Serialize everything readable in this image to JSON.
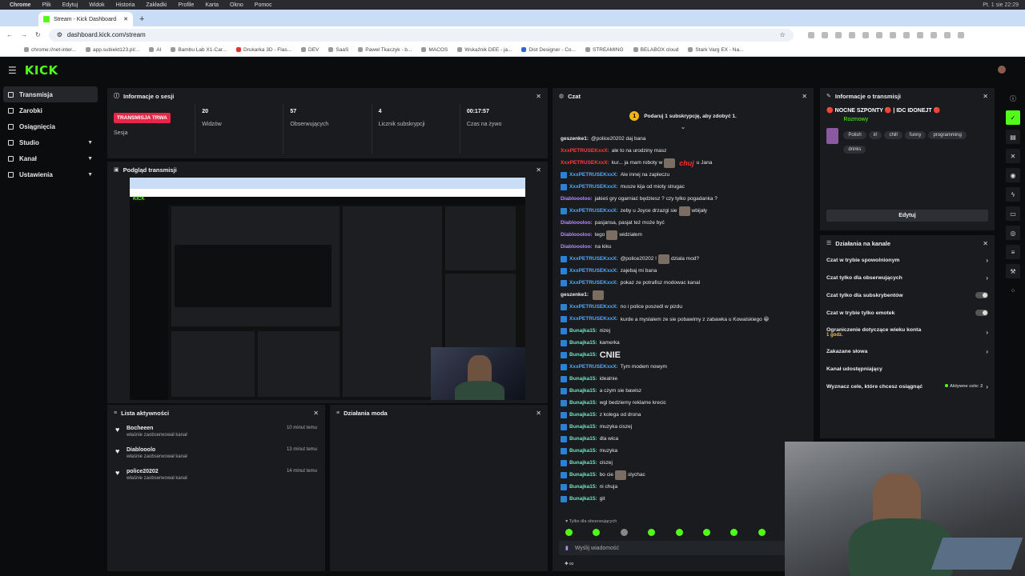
{
  "mac": {
    "apple": "",
    "menu": [
      "Chrome",
      "Plik",
      "Edytuj",
      "Widok",
      "Historia",
      "Zakładki",
      "Profile",
      "Karta",
      "Okno",
      "Pomoc"
    ],
    "clock": "Pt. 1 sie 22:29"
  },
  "browser": {
    "tab_title": "Stream - Kick Dashboard",
    "url": "dashboard.kick.com/stream",
    "bookmarks": [
      "chrome://net-inter...",
      "app.subiekt123.pl/...",
      "AI",
      "Bambu Lab X1-Car...",
      "Drukarka 3D - Flas...",
      "DEV",
      "SaaS",
      "Paweł Tkaczyk - b...",
      "MACOS",
      "Wskaźnik DEE - ja...",
      "Dist Designer - Co...",
      "STREAMING",
      "BELABOX cloud",
      "Stark Varg EX - Na..."
    ]
  },
  "header": {
    "logo": "KICK"
  },
  "sidebar": {
    "items": [
      {
        "label": "Transmisja",
        "icon": "broadcast-icon",
        "active": true
      },
      {
        "label": "Zarobki",
        "icon": "wallet-icon"
      },
      {
        "label": "Osiągnięcia",
        "icon": "trophy-icon"
      },
      {
        "label": "Studio",
        "icon": "studio-icon",
        "chevron": true
      },
      {
        "label": "Kanał",
        "icon": "channel-icon",
        "chevron": true
      },
      {
        "label": "Ustawienia",
        "icon": "gear-icon",
        "chevron": true
      }
    ]
  },
  "session": {
    "title": "Informacje o sesji",
    "live_badge": "TRANSMISJA TRWA",
    "stats": [
      {
        "value": "",
        "label": "Sesja"
      },
      {
        "value": "20",
        "label": "Widzów"
      },
      {
        "value": "57",
        "label": "Obserwujących"
      },
      {
        "value": "4",
        "label": "Licznik subskrypcji"
      },
      {
        "value": "00:17:57",
        "label": "Czas na żywo"
      }
    ]
  },
  "preview": {
    "title": "Podgląd transmisji"
  },
  "activity": {
    "title": "Lista aktywności",
    "items": [
      {
        "name": "Bocheeen",
        "sub": "właśnie zaobserwował kanał",
        "time": "10 minut temu"
      },
      {
        "name": "Diablooolo",
        "sub": "właśnie zaobserwował kanał",
        "time": "13 minut temu"
      },
      {
        "name": "police20202",
        "sub": "właśnie zaobserwował kanał",
        "time": "14 minut temu"
      }
    ]
  },
  "mod": {
    "title": "Działania moda"
  },
  "chat": {
    "title": "Czat",
    "banner": "Podaruj 1 subskrypcję, aby zdobyć 1.",
    "banner_coin": "1",
    "follower_note": "Tylko dla obserwujących",
    "input_placeholder": "Wyślij wiadomość",
    "messages": [
      {
        "user": "geszenke1:",
        "color": "white",
        "text": "@police20202 daj bana"
      },
      {
        "user": "XxxPETRUSEKxxX:",
        "color": "red",
        "text": "ale to na urodziny masz"
      },
      {
        "user": "XxxPETRUSEKxxX:",
        "color": "red",
        "text": "kur... ja mam roboty w",
        "red": "chuj",
        "tail": "u Jana",
        "emote": true
      },
      {
        "user": "XxxPETRUSEKxxX:",
        "color": "blue",
        "badge": true,
        "text": "Ale innej na zapleczu"
      },
      {
        "user": "XxxPETRUSEKxxX:",
        "color": "blue",
        "badge": true,
        "text": "musze kija od mioty strugac"
      },
      {
        "user": "Diabloooloo:",
        "color": "purple",
        "text": "jakieś gry ogarniać będziesz ? czy tylko pogadanka ?"
      },
      {
        "user": "XxxPETRUSEKxxX:",
        "color": "blue",
        "badge": true,
        "text": "zeby u Joyce drzazgi sie",
        "tail": "wbijały",
        "emote": true
      },
      {
        "user": "Diabloooloo:",
        "color": "purple",
        "text": "pasjansa, pasjat też może być"
      },
      {
        "user": "Diabloooloo:",
        "color": "purple",
        "text": "tego",
        "tail": "widziałem",
        "emote": true
      },
      {
        "user": "Diabloooloo:",
        "color": "purple",
        "text": "na kiku"
      },
      {
        "user": "XxxPETRUSEKxxX:",
        "color": "blue",
        "badge": true,
        "text": "@police20202 !",
        "tail": "dziala mod?",
        "emote": true
      },
      {
        "user": "XxxPETRUSEKxxX:",
        "color": "blue",
        "badge": true,
        "text": "zajebaj mi bana"
      },
      {
        "user": "XxxPETRUSEKxxX:",
        "color": "blue",
        "badge": true,
        "text": "pokaz ze potrafisz modowac kanal"
      },
      {
        "user": "geszenke1:",
        "color": "white",
        "text": "",
        "emote": true
      },
      {
        "user": "XxxPETRUSEKxxX:",
        "color": "blue",
        "badge": true,
        "text": "no i police poszedl w pizdu"
      },
      {
        "user": "XxxPETRUSEKxxX:",
        "color": "blue",
        "badge": true,
        "text": "kurde a myslalem ze sie pobawimy z zabawka u Kowalskiego 😀"
      },
      {
        "user": "Bunajka15:",
        "color": "green",
        "badge": true,
        "text": "nizej"
      },
      {
        "user": "Bunajka15:",
        "color": "green",
        "badge": true,
        "text": "kamerka"
      },
      {
        "user": "Bunajka15:",
        "color": "green",
        "badge": true,
        "text": "CNIE",
        "big": true
      },
      {
        "user": "XxxPETRUSEKxxX:",
        "color": "blue",
        "badge": true,
        "text": "Tym modem nowym"
      },
      {
        "user": "Bunajka15:",
        "color": "green",
        "badge": true,
        "text": "idealnie"
      },
      {
        "user": "Bunajka15:",
        "color": "green",
        "badge": true,
        "text": "a czym sie bawisz"
      },
      {
        "user": "Bunajka15:",
        "color": "green",
        "badge": true,
        "text": "wgl bedziemy reklame krecic"
      },
      {
        "user": "Bunajka15:",
        "color": "green",
        "badge": true,
        "text": "z kolega od drona"
      },
      {
        "user": "Bunajka15:",
        "color": "green",
        "badge": true,
        "text": "muzyka ciszej"
      },
      {
        "user": "Bunajka15:",
        "color": "green",
        "badge": true,
        "text": "dla wica"
      },
      {
        "user": "Bunajka15:",
        "color": "green",
        "badge": true,
        "text": "muzyka"
      },
      {
        "user": "Bunajka15:",
        "color": "green",
        "badge": true,
        "text": "ciszej"
      },
      {
        "user": "Bunajka15:",
        "color": "green",
        "badge": true,
        "text": "bo cie",
        "tail": "slychac",
        "emote": true
      },
      {
        "user": "Bunajka15:",
        "color": "green",
        "badge": true,
        "text": "ni chuja"
      },
      {
        "user": "Bunajka15:",
        "color": "green",
        "badge": true,
        "text": "git"
      }
    ]
  },
  "stream_info": {
    "title": "Informacje o transmisji",
    "stream_title": "🔴 NOCNE SZPONTY 🔴 | IDC IDONEJT 🔴",
    "category": "Rozmowy",
    "tags": [
      "Polish",
      "irl",
      "chill",
      "funny",
      "programming",
      "drinks"
    ],
    "edit_label": "Edytuj"
  },
  "channel_actions": {
    "title": "Działania na kanale",
    "rows": [
      {
        "label": "Czat w trybie spowolnionym",
        "kind": "chevron"
      },
      {
        "label": "Czat tylko dla obserwujących",
        "kind": "chevron"
      },
      {
        "label": "Czat tylko dla subskrybentów",
        "kind": "toggle"
      },
      {
        "label": "Czat w trybie tylko emotek",
        "kind": "toggle"
      },
      {
        "label": "Ograniczenie dotyczące wieku konta",
        "sub": "1 godz.",
        "kind": "chevron"
      },
      {
        "label": "Zakazane słowa",
        "kind": "chevron"
      },
      {
        "label": "Kanał udostępniający",
        "kind": "none"
      },
      {
        "label": "Wyznacz cele, które chcesz osiągnąć",
        "kind": "active",
        "active_text": "Aktywne cele: 2"
      }
    ]
  },
  "colors": {
    "accent": "#53fc18",
    "live": "#e8264a",
    "panel": "#191b1f",
    "bg": "#0b0c0d"
  }
}
